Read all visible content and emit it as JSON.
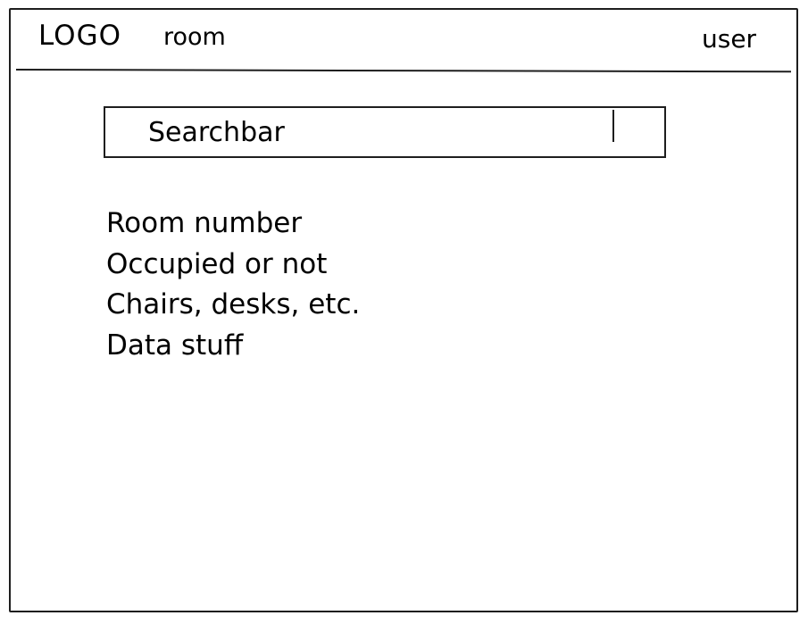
{
  "header": {
    "logo": "LOGO",
    "nav_room": "room",
    "user": "user"
  },
  "search": {
    "placeholder": "Searchbar"
  },
  "room_details": [
    "Room number",
    "Occupied or not",
    "Chairs, desks, etc.",
    "Data stuff"
  ]
}
